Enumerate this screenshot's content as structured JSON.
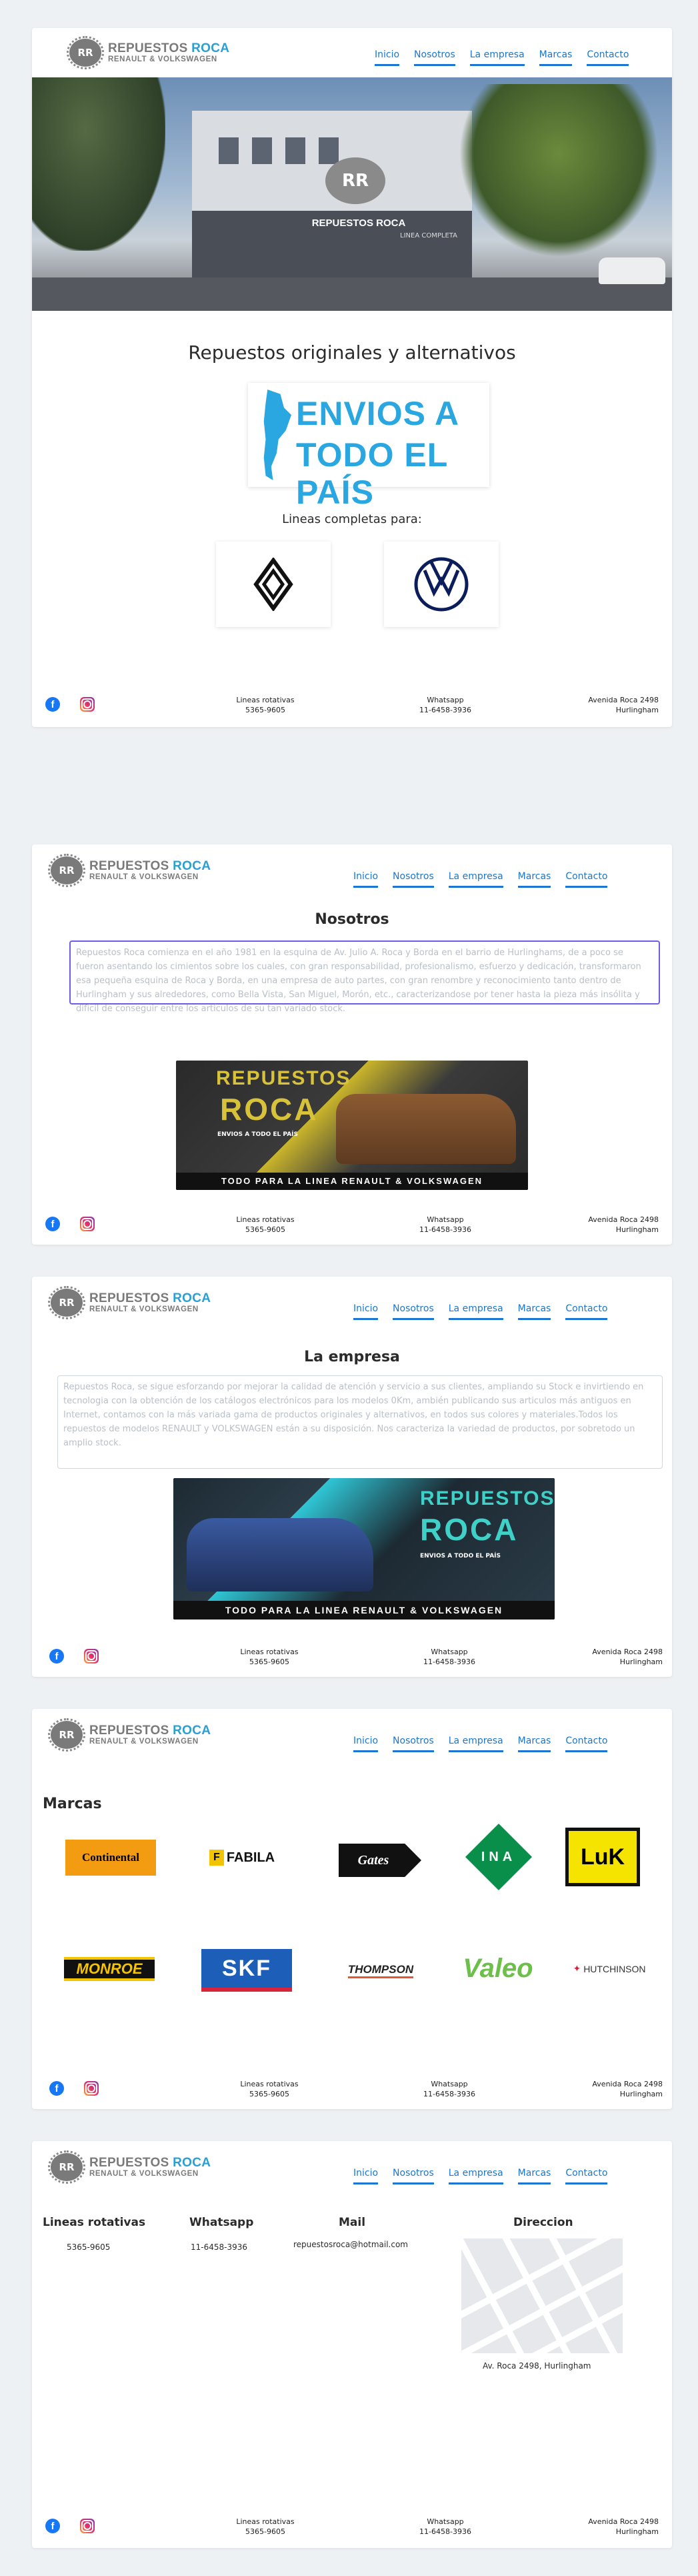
{
  "brand": {
    "name_part1": "REPUESTOS",
    "name_part2": "ROCA",
    "subtitle": "RENAULT & VOLKSWAGEN",
    "emblem_text": "RR"
  },
  "nav": [
    "Inicio",
    "Nosotros",
    "La empresa",
    "Marcas",
    "Contacto"
  ],
  "footer": {
    "col1_title": "Lineas rotativas",
    "col1_value": "5365-9605",
    "col2_title": "Whatsapp",
    "col2_value": "11-6458-3936",
    "col3_title": "Avenida Roca 2498",
    "col3_value": "Hurlingham"
  },
  "home": {
    "hero_sign": "REPUESTOS ROCA",
    "hero_sign_sub": "LINEA COMPLETA",
    "heading": "Repuestos originales y alternativos",
    "shipping_line1": "ENVIOS A",
    "shipping_line2": "TODO EL PAÍS",
    "lines_label": "Lineas completas para:",
    "brands": [
      "renault-logo",
      "volkswagen-logo"
    ]
  },
  "nosotros": {
    "heading": "Nosotros",
    "text": "Repuestos Roca comienza en el año 1981 en la esquina de Av. Julio A. Roca y Borda en el barrio de Hurlinghams, de a poco se fueron asentando los cimientos sobre los cuales, con gran responsabilidad, profesionalismo, esfuerzo y dedicación, transformaron esa pequeña esquina de Roca y Borda, en una empresa de auto partes, con gran renombre y reconocimiento tanto dentro de Hurlingham y sus alrededores, como Bella Vista, San Miguel, Morón, etc., caracterizandose por tener hasta la pieza más insólita y difícil de conseguir entre los artículos de su tan variado stock.",
    "banner_title1": "REPUESTOS",
    "banner_title2": "ROCA",
    "banner_sub": "ENVIOS A TODO EL PAÍS",
    "banner_footer": "TODO PARA LA LINEA RENAULT & VOLKSWAGEN"
  },
  "empresa": {
    "heading": "La empresa",
    "text": "Repuestos Roca, se sigue esforzando por mejorar la calidad de atención y servicio a sus clientes, ampliando su Stock e invirtiendo en tecnologia con la obtención de los catálogos electrónicos para los modelos 0Km, ambién publicando sus articulos más antiguos en Internet, contamos con la más variada gama de productos originales y alternativos, en todos sus colores y materiales.Todos los repuestos de modelos RENAULT y VOLKSWAGEN están a su disposición. Nos caracteriza la variedad de productos, por sobretodo un amplio stock.",
    "banner_title1": "REPUESTOS",
    "banner_title2": "ROCA",
    "banner_sub": "ENVIOS A TODO EL PAÍS",
    "banner_footer": "TODO PARA LA LINEA RENAULT & VOLKSWAGEN"
  },
  "marcas": {
    "heading": "Marcas",
    "logos": [
      {
        "text": "Continental",
        "bg": "#f39c12",
        "color": "#000"
      },
      {
        "text": "FABILA",
        "bg": "#ffffff",
        "color": "#111"
      },
      {
        "text": "Gates",
        "bg": "#111111",
        "color": "#fff"
      },
      {
        "text": "INA",
        "bg": "#0a8f4a",
        "color": "#fff"
      },
      {
        "text": "LuK",
        "bg": "#f5e400",
        "color": "#000"
      },
      {
        "text": "MONROE",
        "bg": "#111111",
        "color": "#f5c400"
      },
      {
        "text": "SKF",
        "bg": "#1d5fb8",
        "color": "#fff"
      },
      {
        "text": "THOMPSON",
        "bg": "#ffffff",
        "color": "#222"
      },
      {
        "text": "Valeo",
        "bg": "#ffffff",
        "color": "#6cc04a"
      },
      {
        "text": "HUTCHINSON",
        "bg": "#ffffff",
        "color": "#333"
      }
    ]
  },
  "contacto": {
    "col1_title": "Lineas rotativas",
    "col1_value": "5365-9605",
    "col2_title": "Whatsapp",
    "col2_value": "11-6458-3936",
    "col3_title": "Mail",
    "col3_value": "repuestosroca@hotmail.com",
    "col4_title": "Direccion",
    "address": "Av. Roca 2498, Hurlingham"
  }
}
